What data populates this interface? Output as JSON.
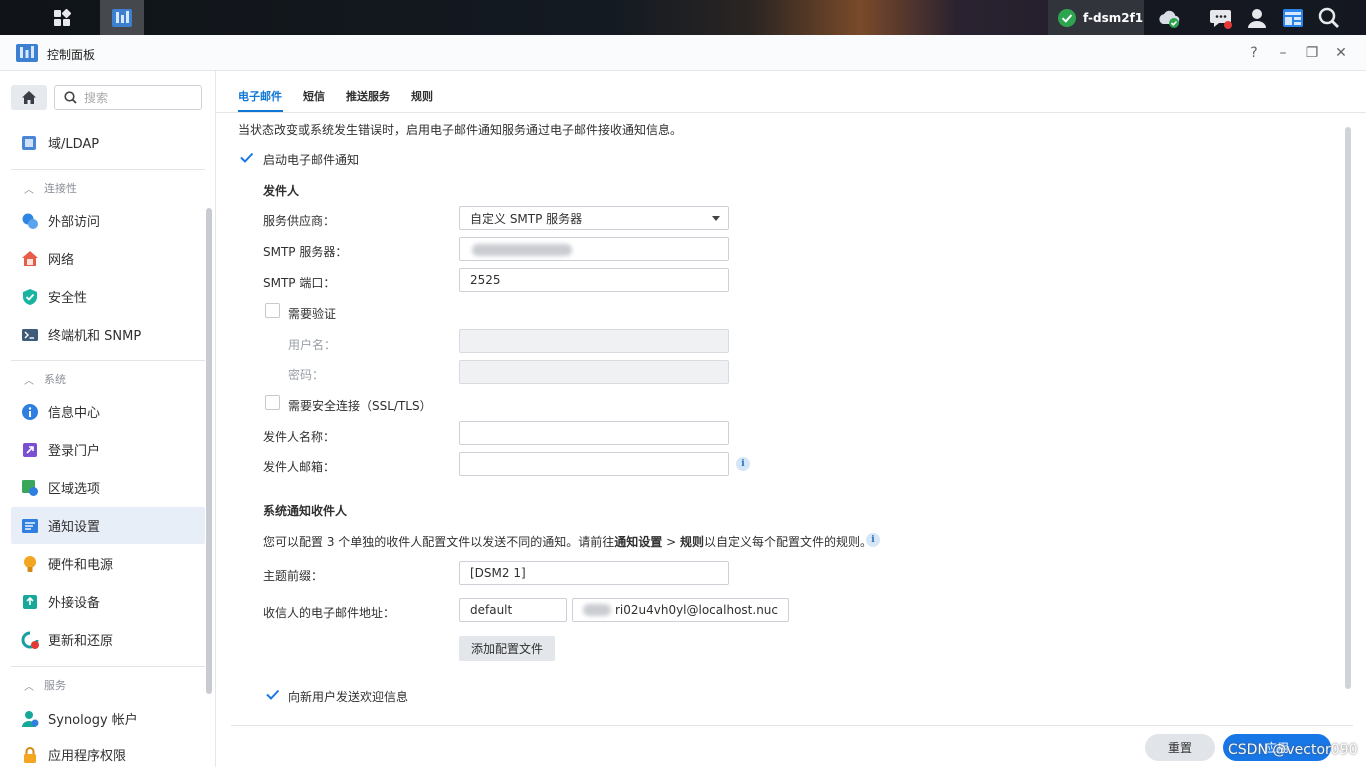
{
  "taskbar": {
    "hostname": "f-dsm2f1",
    "icons": [
      "main-menu-icon",
      "control-panel-icon",
      "status-ok-icon",
      "cloud-sync-icon",
      "chat-icon",
      "user-icon",
      "widgets-icon",
      "search-icon"
    ],
    "accent": "#2ea44f"
  },
  "window": {
    "title": "控制面板",
    "controls": {
      "help": "?",
      "minimize": "–",
      "restore": "❐",
      "close": "✕"
    }
  },
  "sidebar": {
    "search_placeholder": "搜索",
    "top_item": {
      "label": "域/LDAP",
      "icon": "domain-ldap-icon"
    },
    "sections": [
      {
        "title": "连接性",
        "items": [
          {
            "label": "外部访问",
            "icon": "external-access-icon"
          },
          {
            "label": "网络",
            "icon": "network-icon"
          },
          {
            "label": "安全性",
            "icon": "security-shield-icon"
          },
          {
            "label": "终端机和 SNMP",
            "icon": "terminal-icon"
          }
        ]
      },
      {
        "title": "系统",
        "items": [
          {
            "label": "信息中心",
            "icon": "info-center-icon"
          },
          {
            "label": "登录门户",
            "icon": "login-portal-icon"
          },
          {
            "label": "区域选项",
            "icon": "regional-options-icon"
          },
          {
            "label": "通知设置",
            "icon": "notification-icon",
            "active": true
          },
          {
            "label": "硬件和电源",
            "icon": "hardware-power-icon"
          },
          {
            "label": "外接设备",
            "icon": "external-devices-icon"
          },
          {
            "label": "更新和还原",
            "icon": "update-restore-icon"
          }
        ]
      },
      {
        "title": "服务",
        "items": [
          {
            "label": "Synology 帐户",
            "icon": "synology-account-icon"
          },
          {
            "label": "应用程序权限",
            "icon": "app-privileges-icon"
          }
        ]
      }
    ]
  },
  "tabs": [
    "电子邮件",
    "短信",
    "推送服务",
    "规则"
  ],
  "email": {
    "description": "当状态改变或系统发生错误时，启用电子邮件通知服务通过电子邮件接收通知信息。",
    "enable_label": "启动电子邮件通知",
    "enable_checked": true,
    "sender_heading": "发件人",
    "provider_label": "服务供应商：",
    "provider_value": "自定义 SMTP 服务器",
    "smtp_server_label": "SMTP 服务器：",
    "smtp_server_value": "",
    "smtp_port_label": "SMTP 端口：",
    "smtp_port_value": "2525",
    "auth_label": "需要验证",
    "auth_checked": false,
    "username_label": "用户名：",
    "password_label": "密码：",
    "ssl_label": "需要安全连接（SSL/TLS）",
    "ssl_checked": false,
    "sender_name_label": "发件人名称：",
    "sender_email_label": "发件人邮箱：",
    "recipients_heading": "系统通知收件人",
    "recipients_desc_pre": "您可以配置 3 个单独的收件人配置文件以发送不同的通知。请前往",
    "recipients_desc_link1": "通知设置",
    "recipients_desc_sep": " > ",
    "recipients_desc_link2": "规则",
    "recipients_desc_post": "以自定义每个配置文件的规则。",
    "subject_prefix_label": "主题前缀：",
    "subject_prefix_value": "[DSM2 1]",
    "recipient_email_label": "收信人的电子邮件地址：",
    "profile_name": "default",
    "recipient_email_value": "ri02u4vh0yl@localhost.nuc",
    "add_profile_button": "添加配置文件",
    "welcome_label": "向新用户发送欢迎信息",
    "welcome_checked": true
  },
  "footer": {
    "reset_button": "重置",
    "apply_button": "应用",
    "accent": "#1877e6"
  },
  "watermark": "CSDN @vector090"
}
